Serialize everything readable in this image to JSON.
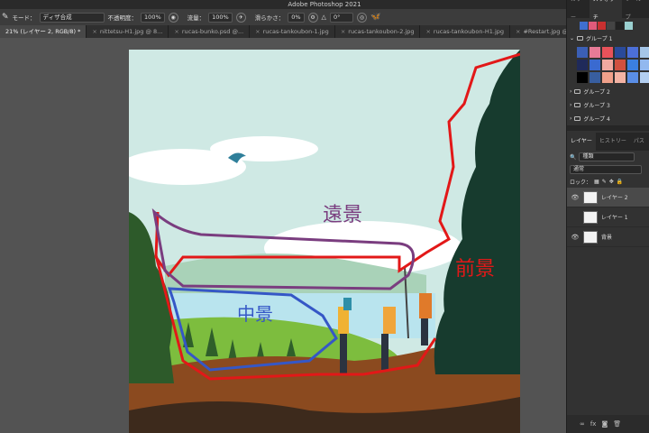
{
  "app": {
    "title": "Adobe Photoshop 2021"
  },
  "options_bar": {
    "mode_label": "モード：",
    "mode_value": "ディザ合成",
    "opacity_label": "不透明度：",
    "opacity_value": "100%",
    "flow_label": "流量：",
    "flow_value": "100%",
    "smoothing_label": "滑らかさ：",
    "smoothing_value": "0%",
    "angle_value": "0°"
  },
  "doc_tabs": [
    {
      "label": "21% (レイヤー 2, RGB/8) *",
      "active": true
    },
    {
      "label": "nittetsu-H1.jpg @ 8...",
      "active": false
    },
    {
      "label": "rucas-bunko.psd @...",
      "active": false
    },
    {
      "label": "rucas-tankoubon-1.jpg",
      "active": false
    },
    {
      "label": "rucas-tankoubon-2.jpg",
      "active": false
    },
    {
      "label": "rucas-tankoubon-H1.jpg",
      "active": false
    },
    {
      "label": "#Restart.jpg @ 90.9...",
      "active": false
    },
    {
      "label": "ka",
      "active": false
    }
  ],
  "swatches_panel": {
    "tabs": [
      "カラー",
      "スウォッチ",
      "ツールプ"
    ],
    "active_tab": "スウォッチ",
    "recent": [
      "#3f6fd0",
      "#e05a7a",
      "#c83030",
      "#444444",
      "#222222",
      "#9ad0d0"
    ],
    "groups": [
      {
        "label": "グループ 1",
        "expanded": true
      },
      {
        "label": "グループ 2",
        "expanded": false
      },
      {
        "label": "グループ 3",
        "expanded": false
      },
      {
        "label": "グループ 4",
        "expanded": false
      }
    ],
    "group1_colors": [
      "#3b5fb5",
      "#e77b97",
      "#e8525a",
      "#2a4a9a",
      "#4c6fd8",
      "#a5c6e8",
      "#1f2a5a",
      "#3a6ad0",
      "#f2a9a0",
      "#d0503f",
      "#3b7fe0",
      "#92b8ef",
      "#000000",
      "#385e9f",
      "#f0a08a",
      "#f3b3a4",
      "#5a8ee6",
      "#b3cff1"
    ]
  },
  "layers_panel": {
    "tabs": [
      "レイヤー",
      "ヒストリー",
      "パス"
    ],
    "active_tab": "レイヤー",
    "filter_label": "種類",
    "blend_mode": "通常",
    "lock_label": "ロック：",
    "layers": [
      {
        "name": "レイヤー 2",
        "visible": true,
        "active": true
      },
      {
        "name": "レイヤー 1",
        "visible": false,
        "active": false
      },
      {
        "name": "背景",
        "visible": true,
        "active": false
      }
    ]
  },
  "annotations": {
    "far": "遠景",
    "mid": "中景",
    "near": "前景",
    "far_color": "#7a3d7f",
    "mid_color": "#3557c6",
    "near_color": "#e21818"
  }
}
